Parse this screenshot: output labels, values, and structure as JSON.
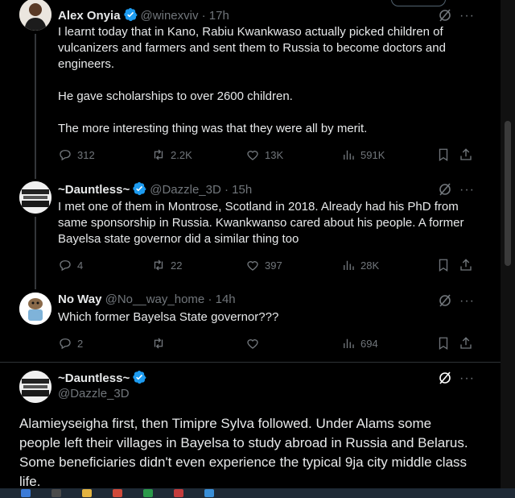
{
  "tweets": [
    {
      "name": "Alex Onyia",
      "handle": "@winexviv",
      "time": "· 17h",
      "body": [
        "I learnt today that in Kano, Rabiu Kwankwaso actually picked children of vulcanizers and farmers and sent them to Russia to become doctors and engineers.",
        "He gave scholarships to over 2600 children.",
        "The more interesting thing was that they were all by merit."
      ],
      "replies": "312",
      "reposts": "2.2K",
      "likes": "13K",
      "views": "591K"
    },
    {
      "name": "~Dauntless~",
      "handle": "@Dazzle_3D",
      "time": "· 15h",
      "body": "I met one of them in Montrose, Scotland in 2018. Already had his PhD from same sponsorship in Russia. Kwankwanso cared about his people. A former Bayelsa state governor did a similar thing too",
      "replies": "4",
      "reposts": "22",
      "likes": "397",
      "views": "28K"
    },
    {
      "name": "No Way",
      "handle": "@No__way_home",
      "time": "· 14h",
      "body": "Which former Bayelsa State governor???",
      "replies": "2",
      "reposts": "",
      "likes": "",
      "views": "694"
    }
  ],
  "focused": {
    "name": "~Dauntless~",
    "handle": "@Dazzle_3D",
    "body": "Alamieyseigha first, then Timipre Sylva followed. Under Alams some people left their villages in Bayelsa to study abroad in Russia and Belarus. Some beneficiaries didn't even experience the typical 9ja city middle class life."
  },
  "more_glyph": "···",
  "colors": {
    "verified": "#1d9bf0",
    "muted": "#71767b",
    "divider": "#2f3336"
  },
  "icons": [
    "reply-icon",
    "repost-icon",
    "like-icon",
    "views-icon",
    "bookmark-icon",
    "share-icon",
    "grok-icon",
    "more-icon",
    "verified-icon"
  ]
}
